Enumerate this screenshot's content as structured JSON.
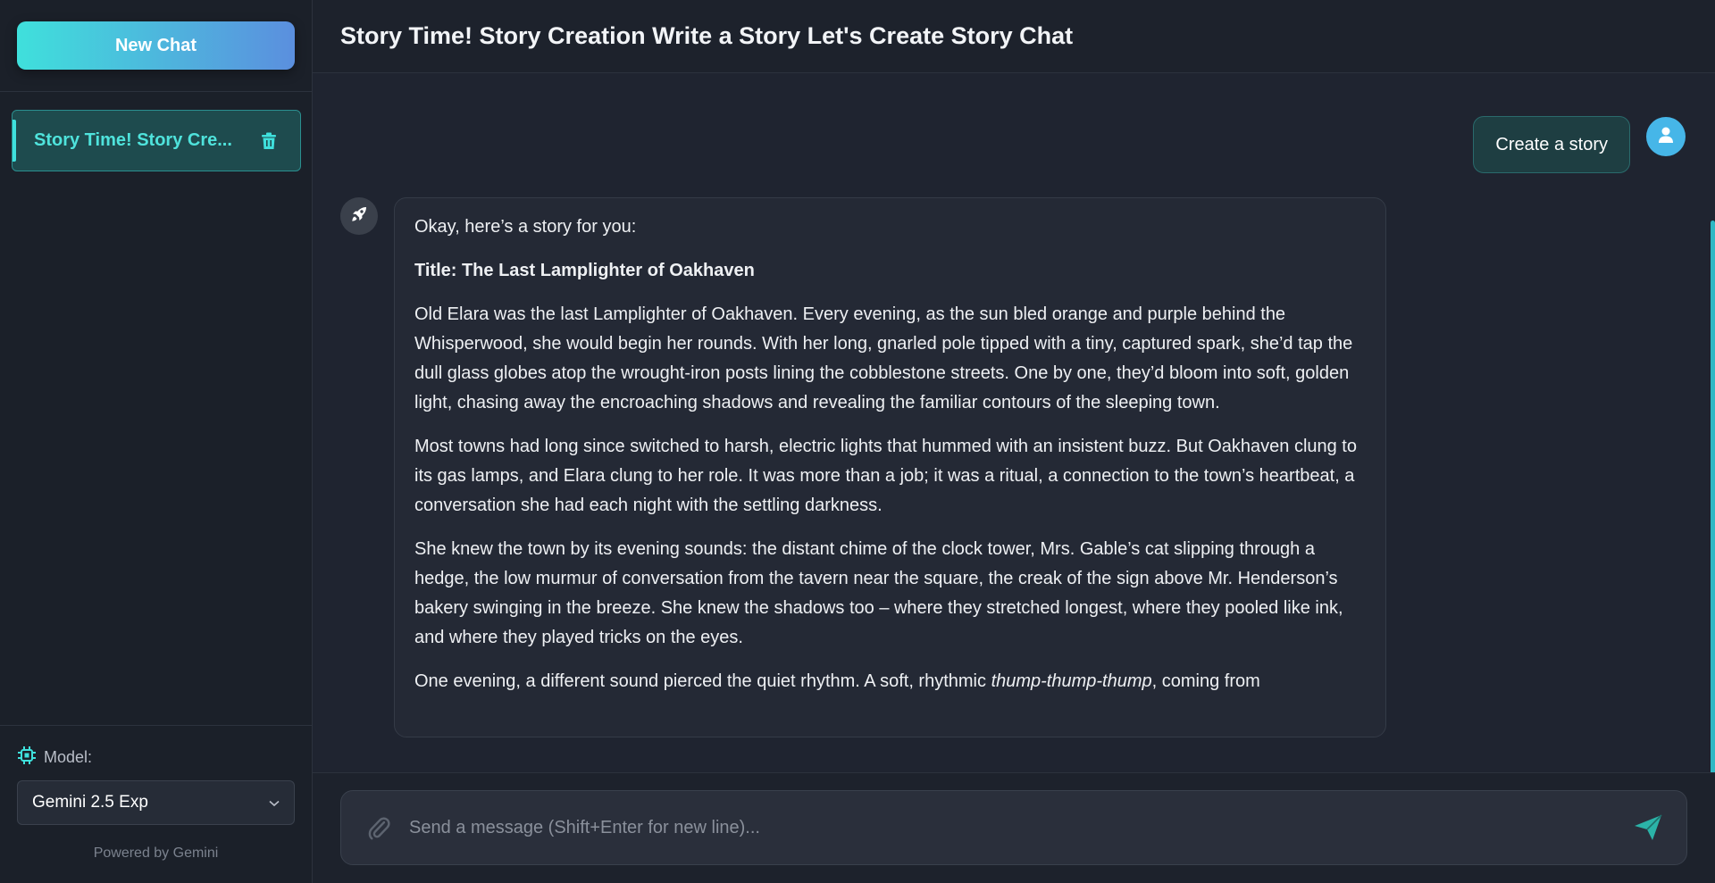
{
  "sidebar": {
    "new_chat_label": "New Chat",
    "chats": [
      {
        "label": "Story Time! Story Cre..."
      }
    ],
    "model_label": "Model:",
    "model_value": "Gemini 2.5 Exp",
    "powered_by": "Powered by Gemini"
  },
  "header": {
    "title": "Story Time! Story Creation Write a Story Let's Create Story Chat"
  },
  "messages": {
    "user_message": "Create a story",
    "bot": {
      "intro": "Okay, here’s a story for you:",
      "title": "Title: The Last Lamplighter of Oakhaven",
      "p1": "Old Elara was the last Lamplighter of Oakhaven. Every evening, as the sun bled orange and purple behind the Whisperwood, she would begin her rounds. With her long, gnarled pole tipped with a tiny, captured spark, she’d tap the dull glass globes atop the wrought-iron posts lining the cobblestone streets. One by one, they’d bloom into soft, golden light, chasing away the encroaching shadows and revealing the familiar contours of the sleeping town.",
      "p2": "Most towns had long since switched to harsh, electric lights that hummed with an insistent buzz. But Oakhaven clung to its gas lamps, and Elara clung to her role. It was more than a job; it was a ritual, a connection to the town’s heartbeat, a conversation she had each night with the settling darkness.",
      "p3": "She knew the town by its evening sounds: the distant chime of the clock tower, Mrs. Gable’s cat slipping through a hedge, the low murmur of conversation from the tavern near the square, the creak of the sign above Mr. Henderson’s bakery swinging in the breeze. She knew the shadows too – where they stretched longest, where they pooled like ink, and where they played tricks on the eyes.",
      "p4_start": "One evening, a different sound pierced the quiet rhythm. A soft, rhythmic ",
      "p4_em": "thump-thump-thump",
      "p4_end": ", coming from"
    }
  },
  "input": {
    "placeholder": "Send a message (Shift+Enter for new line)..."
  },
  "colors": {
    "accent": "#3fe0dc",
    "accent_blue": "#5b8fde",
    "send": "#2bb3a8"
  },
  "icons": {
    "trash": "trash-icon",
    "chip": "chip-icon",
    "chevron": "chevron-down-icon",
    "user": "user-icon",
    "bot": "rocket-icon",
    "attach": "paperclip-icon",
    "send": "send-icon"
  }
}
